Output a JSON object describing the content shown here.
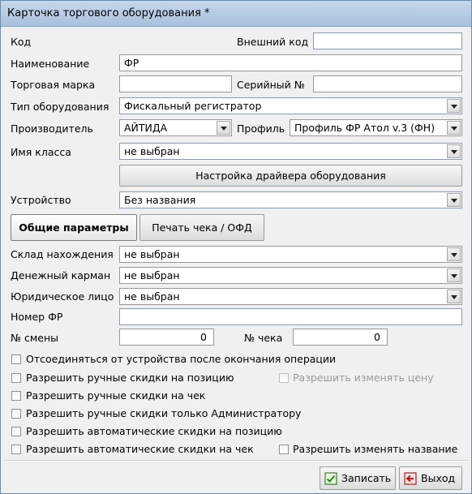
{
  "window": {
    "title": "Карточка торгового оборудования *"
  },
  "fields": {
    "code_label": "Код",
    "ext_code_label": "Внешний код",
    "ext_code_value": "",
    "name_label": "Наименование",
    "name_value": "ФР",
    "brand_label": "Торговая марка",
    "brand_value": "",
    "serial_label": "Серийный №",
    "serial_value": "",
    "type_label": "Тип оборудования",
    "type_value": "Фискальный регистратор",
    "maker_label": "Производитель",
    "maker_value": "АЙТИДА",
    "profile_label": "Профиль",
    "profile_value": "Профиль ФР Атол v.3 (ФН)",
    "class_label": "Имя класса",
    "class_value": "не выбран",
    "driver_button": "Настройка драйвера оборудования",
    "device_label": "Устройство",
    "device_value": "Без названия"
  },
  "tabs": [
    {
      "label": "Общие параметры",
      "active": true
    },
    {
      "label": "Печать чека / ОФД",
      "active": false
    }
  ],
  "general": {
    "warehouse_label": "Склад нахождения",
    "warehouse_value": "не выбран",
    "cashbox_label": "Денежный карман",
    "cashbox_value": "не выбран",
    "legal_label": "Юридическое лицо",
    "legal_value": "не выбран",
    "fr_number_label": "Номер ФР",
    "fr_number_value": "",
    "shift_label": "№ смены",
    "shift_value": "0",
    "check_label": "№ чека",
    "check_value": "0"
  },
  "checkboxes": {
    "disconnect": "Отсоединяться от устройства после окончания операции",
    "manual_pos": "Разрешить ручные скидки на позицию",
    "change_price": "Разрешить изменять цену",
    "manual_check": "Разрешить ручные скидки на чек",
    "manual_admin": "Разрешить ручные скидки только Администратору",
    "auto_pos": "Разрешить автоматические скидки на позицию",
    "auto_check": "Разрешить автоматические скидки на чек",
    "change_name": "Разрешить изменять название"
  },
  "footer": {
    "save_label": "Записать",
    "exit_label": "Выход"
  },
  "colors": {
    "titlebar": "#b8cde4",
    "window_bg": "#f0f0f0"
  }
}
